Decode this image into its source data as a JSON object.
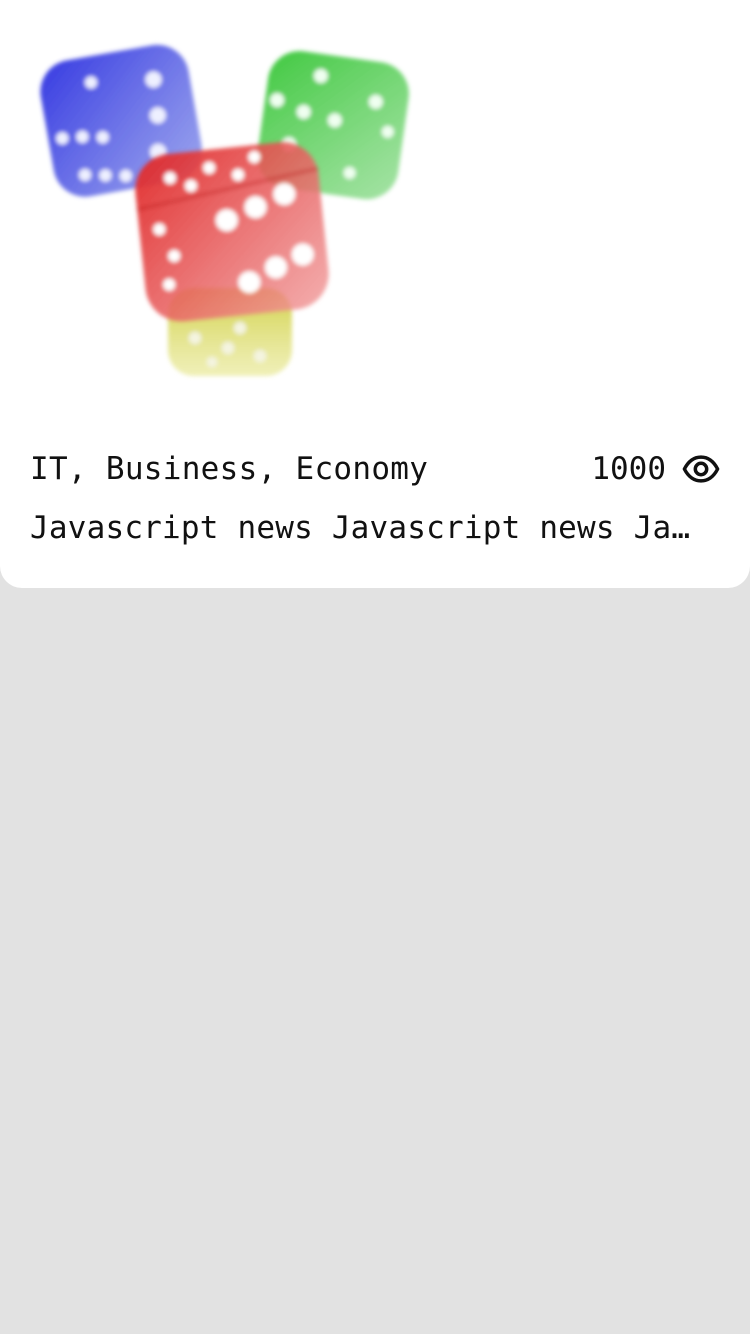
{
  "card": {
    "image_icon": "dice-image",
    "tags": "IT, Business, Economy",
    "views": "1000",
    "views_icon": "eye-icon",
    "title": "Javascript news Javascript news Javascript news Javascript news"
  },
  "colors": {
    "page_background": "#e2e2e2",
    "card_background": "#ffffff",
    "text": "#111111",
    "die_blue": "#3a3fd8",
    "die_green": "#3fc23f",
    "die_red": "#e23b3b",
    "die_yellow": "#cfcf3a"
  }
}
